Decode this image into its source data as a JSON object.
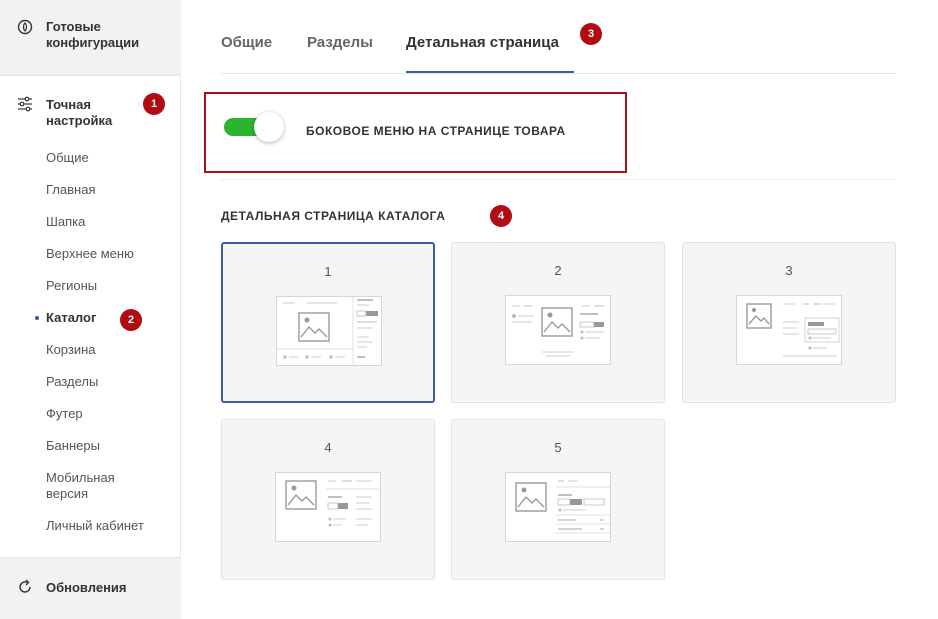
{
  "sidebar": {
    "top_block": {
      "label": "Готовые конфигурации",
      "icon": "palette-icon"
    },
    "fine_tune": {
      "label": "Точная настройка",
      "icon": "sliders-icon"
    },
    "items": [
      {
        "label": "Общие"
      },
      {
        "label": "Главная"
      },
      {
        "label": "Шапка"
      },
      {
        "label": "Верхнее меню"
      },
      {
        "label": "Регионы"
      },
      {
        "label": "Каталог",
        "active": true
      },
      {
        "label": "Корзина"
      },
      {
        "label": "Разделы"
      },
      {
        "label": "Футер"
      },
      {
        "label": "Баннеры"
      },
      {
        "label": "Мобильная версия"
      },
      {
        "label": "Личный кабинет"
      }
    ],
    "bottom_block": {
      "label": "Обновления",
      "icon": "refresh-icon"
    }
  },
  "badges": {
    "b1": "1",
    "b2": "2",
    "b3": "3",
    "b4": "4"
  },
  "tabs": [
    {
      "label": "Общие"
    },
    {
      "label": "Разделы"
    },
    {
      "label": "Детальная страница",
      "active": true
    }
  ],
  "toggle": {
    "label": "БОКОВОЕ МЕНЮ НА СТРАНИЦЕ ТОВАРА",
    "on": true
  },
  "section": {
    "title": "ДЕТАЛЬНАЯ СТРАНИЦА КАТАЛОГА"
  },
  "cards": [
    {
      "num": "1",
      "selected": true
    },
    {
      "num": "2"
    },
    {
      "num": "3"
    },
    {
      "num": "4"
    },
    {
      "num": "5"
    }
  ],
  "colors": {
    "accent": "#3d5aa8",
    "badge": "#b00c12",
    "toggle_on": "#2ab531",
    "highlight_border": "#a31616"
  }
}
